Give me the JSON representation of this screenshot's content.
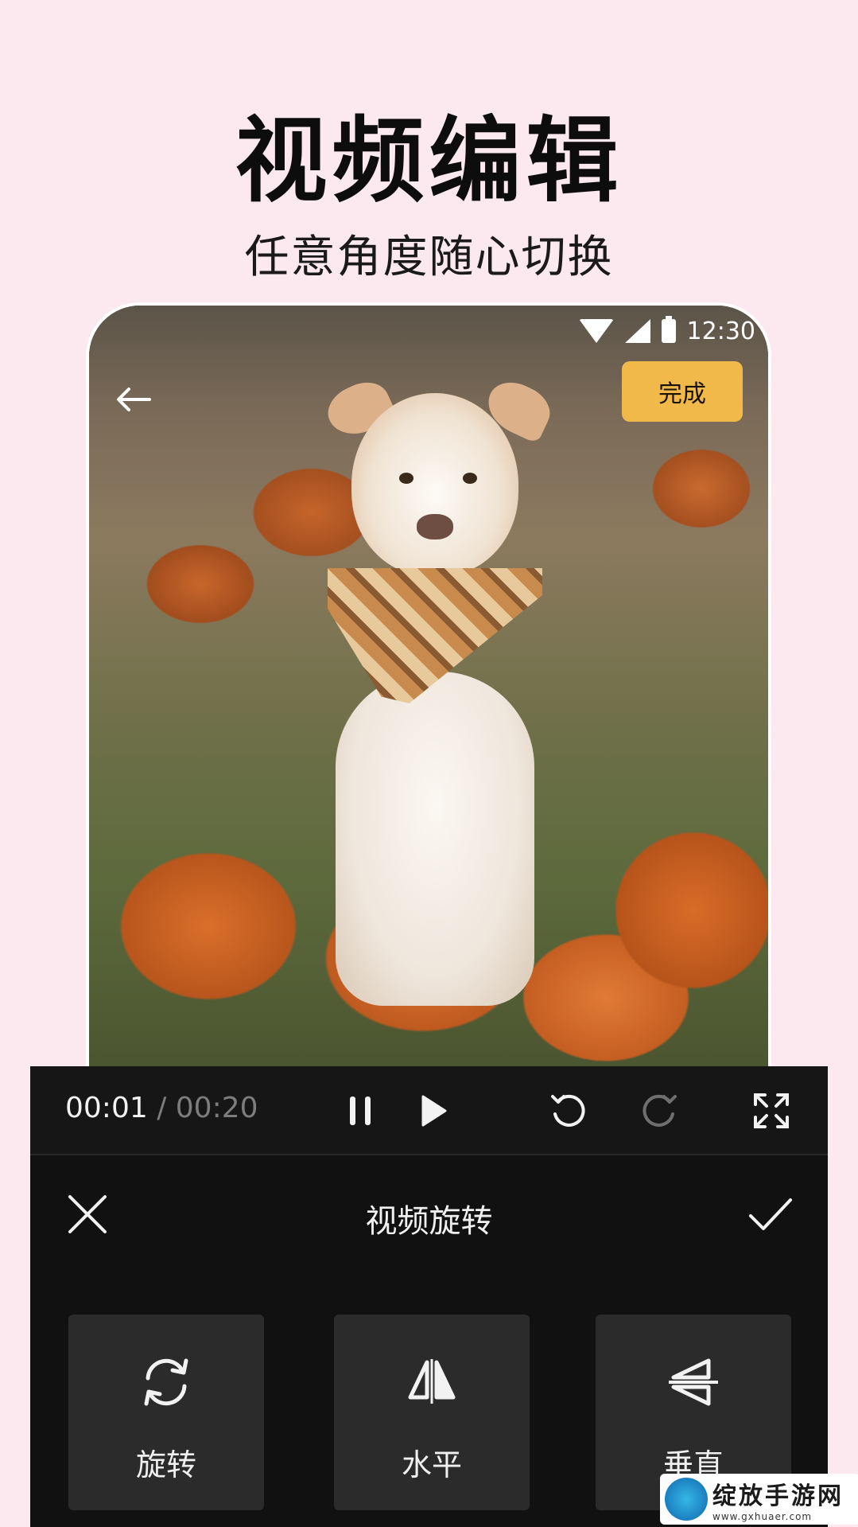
{
  "hero": {
    "title": "视频编辑",
    "subtitle": "任意角度随心切换"
  },
  "status_bar": {
    "time": "12:30",
    "icons": [
      "wifi-icon",
      "signal-icon",
      "battery-icon"
    ]
  },
  "top_bar": {
    "back_icon": "back-arrow-icon",
    "done_label": "完成",
    "done_color": "#f0b94a"
  },
  "player": {
    "current_time": "00:01",
    "separator": " / ",
    "total_time": "00:20",
    "controls": [
      "pause-icon",
      "play-icon",
      "undo-icon",
      "redo-icon",
      "fullscreen-icon"
    ]
  },
  "editor": {
    "title": "视频旋转",
    "close_icon": "close-icon",
    "confirm_icon": "check-icon",
    "tools": [
      {
        "label": "旋转",
        "icon": "rotate-icon"
      },
      {
        "label": "水平",
        "icon": "flip-horizontal-icon"
      },
      {
        "label": "垂直",
        "icon": "flip-vertical-icon"
      }
    ]
  },
  "watermark": {
    "name": "绽放手游网",
    "url": "www.gxhuaer.com"
  },
  "colors": {
    "background": "#fbe9ef",
    "panel": "#111111",
    "tool_tile": "#2b2b2b",
    "accent": "#f0b94a"
  }
}
